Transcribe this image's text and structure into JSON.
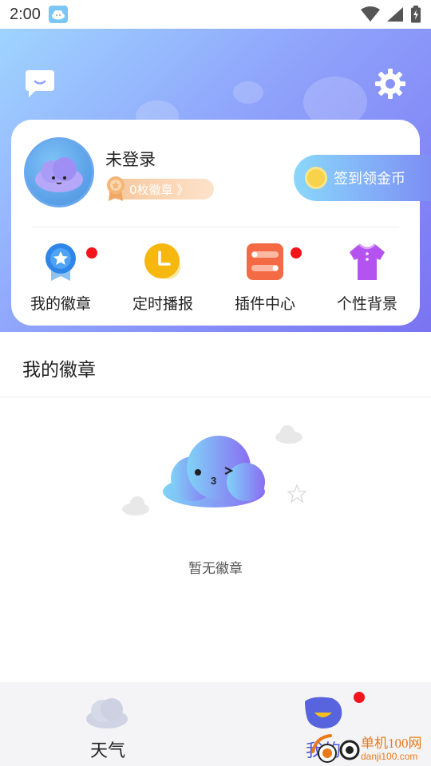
{
  "status_bar": {
    "time": "2:00",
    "icons": [
      "weather-app-icon",
      "wifi-icon",
      "signal-icon",
      "battery-icon"
    ]
  },
  "header": {
    "chat_icon": "chat-bubble-icon",
    "settings_icon": "gear-icon"
  },
  "profile": {
    "username": "未登录",
    "badge_count": "0枚徽章 》",
    "checkin_label": "签到领金币"
  },
  "shortcuts": [
    {
      "label": "我的徽章",
      "icon": "badge-ribbon-icon",
      "has_dot": true
    },
    {
      "label": "定时播报",
      "icon": "clock-icon",
      "has_dot": false
    },
    {
      "label": "插件中心",
      "icon": "toggle-plugins-icon",
      "has_dot": true
    },
    {
      "label": "个性背景",
      "icon": "shirt-icon",
      "has_dot": false
    }
  ],
  "section": {
    "title": "我的徽章",
    "empty_text": "暂无徽章"
  },
  "bottom_nav": {
    "tabs": [
      {
        "label": "天气",
        "icon": "cloud-icon",
        "active": false
      },
      {
        "label": "我的",
        "icon": "profile-blob-icon",
        "active": true,
        "has_dot": true
      }
    ]
  },
  "watermark": {
    "line1": "单机100网",
    "line2": "danji100.com"
  },
  "colors": {
    "header_gradient_start": "#9fd4ff",
    "header_gradient_end": "#7a73f2",
    "notification_dot": "#f5141c",
    "checkin_gradient_start": "#8ad8fb",
    "checkin_gradient_end": "#7d8ef5"
  }
}
